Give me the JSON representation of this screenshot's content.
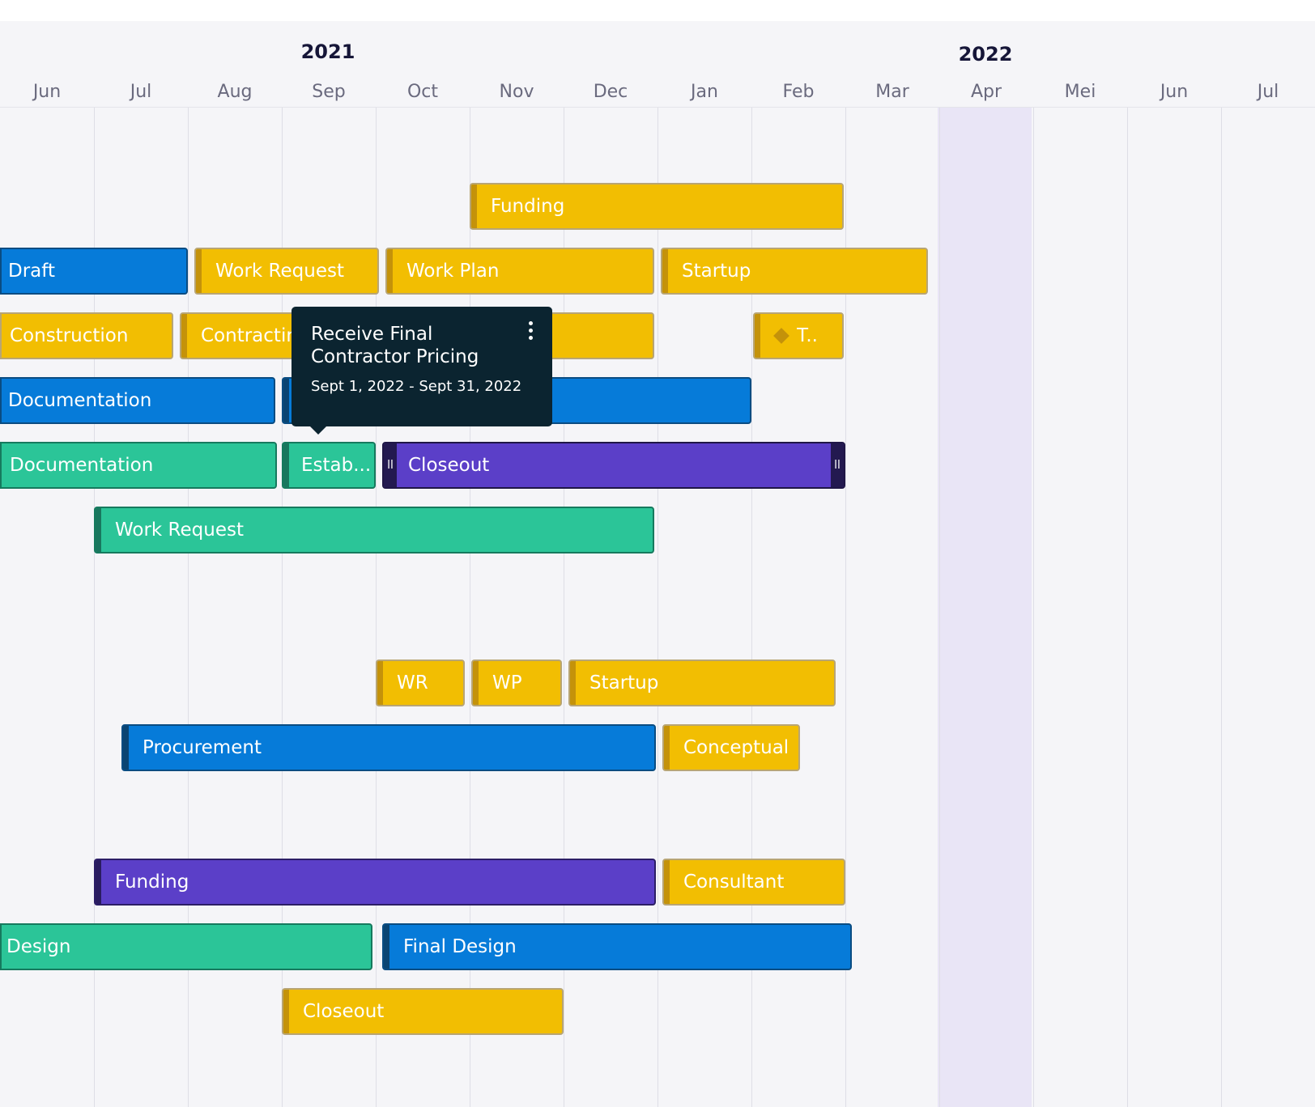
{
  "timeline": {
    "years": [
      "2021",
      "2022"
    ],
    "months": [
      "Jun",
      "Jul",
      "Aug",
      "Sep",
      "Oct",
      "Nov",
      "Dec",
      "Jan",
      "Feb",
      "Mar",
      "Apr",
      "Mei",
      "Jun",
      "Jul"
    ],
    "highlighted_month": "Apr"
  },
  "colors": {
    "yellow": "#f2be02",
    "blue": "#067bd9",
    "green": "#2bc598",
    "purple": "#5b3fc8",
    "tooltip_bg": "#0b2430",
    "highlight_column": "#e9e5f6"
  },
  "rows": [
    [
      {
        "label": "Funding",
        "color": "yellow"
      }
    ],
    [
      {
        "label": "Draft",
        "color": "blue"
      },
      {
        "label": "Work Request",
        "color": "yellow"
      },
      {
        "label": "Work Plan",
        "color": "yellow"
      },
      {
        "label": "Startup",
        "color": "yellow"
      }
    ],
    [
      {
        "label": "Construction",
        "color": "yellow"
      },
      {
        "label": "Contracting",
        "color": "yellow"
      },
      {
        "label": "T..",
        "color": "yellow",
        "icon": "diamond-milestone-icon"
      }
    ],
    [
      {
        "label": "Documentation",
        "color": "blue"
      },
      {
        "label": "",
        "color": "blue"
      }
    ],
    [
      {
        "label": "Documentation",
        "color": "green"
      },
      {
        "label": "Estab...",
        "color": "green"
      },
      {
        "label": "Closeout",
        "color": "purple",
        "selected": true
      }
    ],
    [
      {
        "label": "Work Request",
        "color": "green"
      }
    ],
    [],
    [
      {
        "label": "WR",
        "color": "yellow"
      },
      {
        "label": "WP",
        "color": "yellow"
      },
      {
        "label": "Startup",
        "color": "yellow"
      }
    ],
    [
      {
        "label": "Procurement",
        "color": "blue"
      },
      {
        "label": "Conceptual",
        "color": "yellow"
      }
    ],
    [],
    [
      {
        "label": "Funding",
        "color": "purple"
      },
      {
        "label": "Consultant",
        "color": "yellow"
      }
    ],
    [
      {
        "label": "Design",
        "color": "green"
      },
      {
        "label": "Final Design",
        "color": "blue"
      }
    ],
    [
      {
        "label": "Closeout",
        "color": "yellow"
      }
    ]
  ],
  "tooltip": {
    "title": "Receive Final Contractor Pricing",
    "dates": "Sept 1, 2022 - Sept 31, 2022",
    "menu_icon": "more-vertical-icon"
  }
}
